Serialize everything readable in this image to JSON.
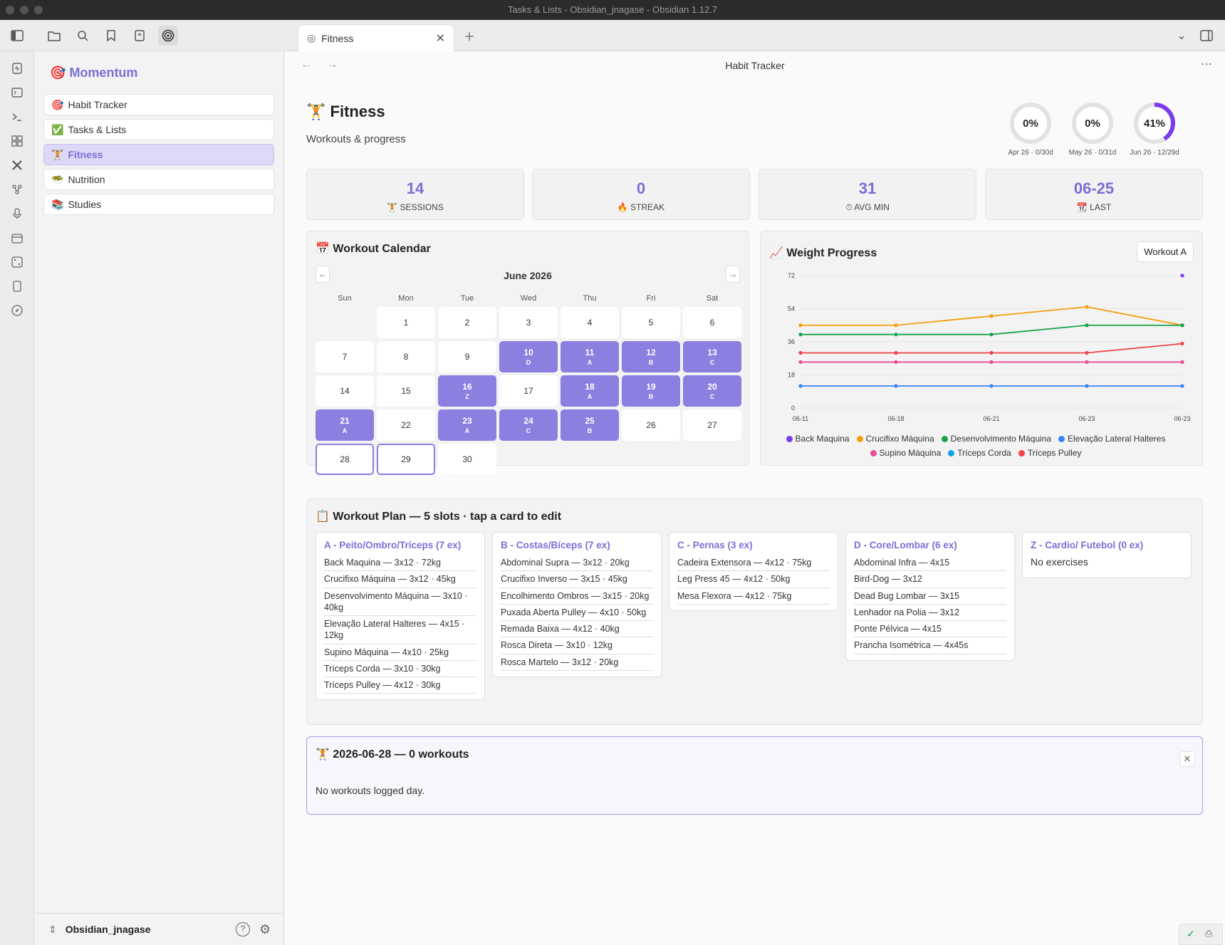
{
  "window": {
    "title": "Tasks & Lists - Obsidian_jnagase - Obsidian 1.12.7"
  },
  "tab": {
    "label": "Fitness"
  },
  "view": {
    "title": "Habit Tracker"
  },
  "sidebar": {
    "title": "Momentum",
    "title_emoji": "🎯",
    "items": [
      {
        "emoji": "🎯",
        "label": "Habit Tracker"
      },
      {
        "emoji": "✅",
        "label": "Tasks & Lists"
      },
      {
        "emoji": "🏋",
        "label": "Fitness"
      },
      {
        "emoji": "🥗",
        "label": "Nutrition"
      },
      {
        "emoji": "📚",
        "label": "Studies"
      }
    ],
    "vault_name": "Obsidian_jnagase"
  },
  "page": {
    "emoji": "🏋",
    "title": "Fitness",
    "subtitle": "Workouts & progress"
  },
  "rings": [
    {
      "value": "0%",
      "pct": 0,
      "label": "Apr 26 · 0/30d"
    },
    {
      "value": "0%",
      "pct": 0,
      "label": "May 26 · 0/31d"
    },
    {
      "value": "41%",
      "pct": 41,
      "label": "Jun 26 · 12/29d"
    }
  ],
  "stats": [
    {
      "value": "14",
      "icon": "🏋",
      "label": "SESSIONS"
    },
    {
      "value": "0",
      "icon": "🔥",
      "label": "STREAK"
    },
    {
      "value": "31",
      "icon": "⏱",
      "label": "AVG MIN"
    },
    {
      "value": "06-25",
      "icon": "📆",
      "label": "LAST"
    }
  ],
  "calendar": {
    "emoji": "📅",
    "title": "Workout Calendar",
    "month": "June 2026",
    "weekdays": [
      "Sun",
      "Mon",
      "Tue",
      "Wed",
      "Thu",
      "Fri",
      "Sat"
    ],
    "days": [
      {
        "n": "1",
        "tag": ""
      },
      {
        "n": "2",
        "tag": ""
      },
      {
        "n": "3",
        "tag": ""
      },
      {
        "n": "4",
        "tag": ""
      },
      {
        "n": "5",
        "tag": ""
      },
      {
        "n": "6",
        "tag": ""
      },
      {
        "n": "7",
        "tag": ""
      },
      {
        "n": "8",
        "tag": ""
      },
      {
        "n": "9",
        "tag": ""
      },
      {
        "n": "10",
        "tag": "D"
      },
      {
        "n": "11",
        "tag": "A"
      },
      {
        "n": "12",
        "tag": "B"
      },
      {
        "n": "13",
        "tag": "C"
      },
      {
        "n": "14",
        "tag": ""
      },
      {
        "n": "15",
        "tag": ""
      },
      {
        "n": "16",
        "tag": "Z"
      },
      {
        "n": "17",
        "tag": ""
      },
      {
        "n": "18",
        "tag": "A"
      },
      {
        "n": "19",
        "tag": "B"
      },
      {
        "n": "20",
        "tag": "C"
      },
      {
        "n": "21",
        "tag": "A"
      },
      {
        "n": "22",
        "tag": ""
      },
      {
        "n": "23",
        "tag": "A"
      },
      {
        "n": "24",
        "tag": "C"
      },
      {
        "n": "25",
        "tag": "B"
      },
      {
        "n": "26",
        "tag": ""
      },
      {
        "n": "27",
        "tag": ""
      },
      {
        "n": "28",
        "tag": ""
      },
      {
        "n": "29",
        "tag": ""
      },
      {
        "n": "30",
        "tag": ""
      }
    ]
  },
  "weight_progress": {
    "emoji": "📈",
    "title": "Weight Progress",
    "button": "Workout A"
  },
  "chart_data": {
    "type": "line",
    "x": [
      "06-11",
      "06-18",
      "06-21",
      "06-23",
      "06-23"
    ],
    "yticks": [
      0,
      18,
      36,
      54,
      72
    ],
    "ylim": [
      0,
      72
    ],
    "series": [
      {
        "name": "Back Maquina",
        "color": "#7c3aed",
        "values": [
          null,
          null,
          null,
          null,
          72
        ]
      },
      {
        "name": "Crucifixo Máquina",
        "color": "#f59e0b",
        "values": [
          45,
          45,
          50,
          55,
          45
        ]
      },
      {
        "name": "Desenvolvimento Máquina",
        "color": "#16a34a",
        "values": [
          40,
          40,
          40,
          45,
          45
        ]
      },
      {
        "name": "Elevação Lateral Halteres",
        "color": "#3b82f6",
        "values": [
          12,
          12,
          12,
          12,
          12
        ]
      },
      {
        "name": "Supino Máquina",
        "color": "#ec4899",
        "values": [
          25,
          25,
          25,
          25,
          25
        ]
      },
      {
        "name": "Tríceps Corda",
        "color": "#0ea5e9",
        "values": [
          null,
          null,
          null,
          null,
          null
        ]
      },
      {
        "name": "Tríceps Pulley",
        "color": "#ef4444",
        "values": [
          30,
          30,
          30,
          30,
          35
        ]
      }
    ]
  },
  "plan": {
    "emoji": "📋",
    "title": "Workout Plan — 5 slots · tap a card to edit",
    "cards": [
      {
        "title": "A - Peito/Ombro/Tríceps (7 ex)",
        "exercises": [
          "Back Maquina — 3x12 · 72kg",
          "Crucifixo Máquina — 3x12 · 45kg",
          "Desenvolvimento Máquina — 3x10 · 40kg",
          "Elevação Lateral Halteres — 4x15 · 12kg",
          "Supino Máquina — 4x10 · 25kg",
          "Tríceps Corda — 3x10 · 30kg",
          "Tríceps Pulley — 4x12 · 30kg"
        ]
      },
      {
        "title": "B - Costas/Bíceps (7 ex)",
        "exercises": [
          "Abdominal Supra — 3x12 · 20kg",
          "Crucifixo Inverso — 3x15 · 45kg",
          "Encolhimento Ombros — 3x15 · 20kg",
          "Puxada Aberta Pulley — 4x10 · 50kg",
          "Remada Baixa — 4x12 · 40kg",
          "Rosca Direta — 3x10 · 12kg",
          "Rosca Martelo — 3x12 · 20kg"
        ]
      },
      {
        "title": "C - Pernas (3 ex)",
        "exercises": [
          "Cadeira Extensora — 4x12 · 75kg",
          "Leg Press 45 — 4x12 · 50kg",
          "Mesa Flexora — 4x12 · 75kg"
        ]
      },
      {
        "title": "D - Core/Lombar (6 ex)",
        "exercises": [
          "Abdominal Infra — 4x15",
          "Bird-Dog — 3x12",
          "Dead Bug Lombar — 3x15",
          "Lenhador na Polia — 3x12",
          "Ponte Pélvica — 4x15",
          "Prancha Isométrica — 4x45s"
        ]
      },
      {
        "title": "Z - Cardio/ Futebol (0 ex)",
        "exercises": [],
        "empty_text": "No exercises"
      }
    ]
  },
  "day_log": {
    "emoji": "🏋",
    "title": "2026-06-28 — 0 workouts",
    "text": "No workouts logged day."
  },
  "colors": {
    "accent": "#7b6fd6",
    "accent_cell": "#8b7fe0"
  }
}
